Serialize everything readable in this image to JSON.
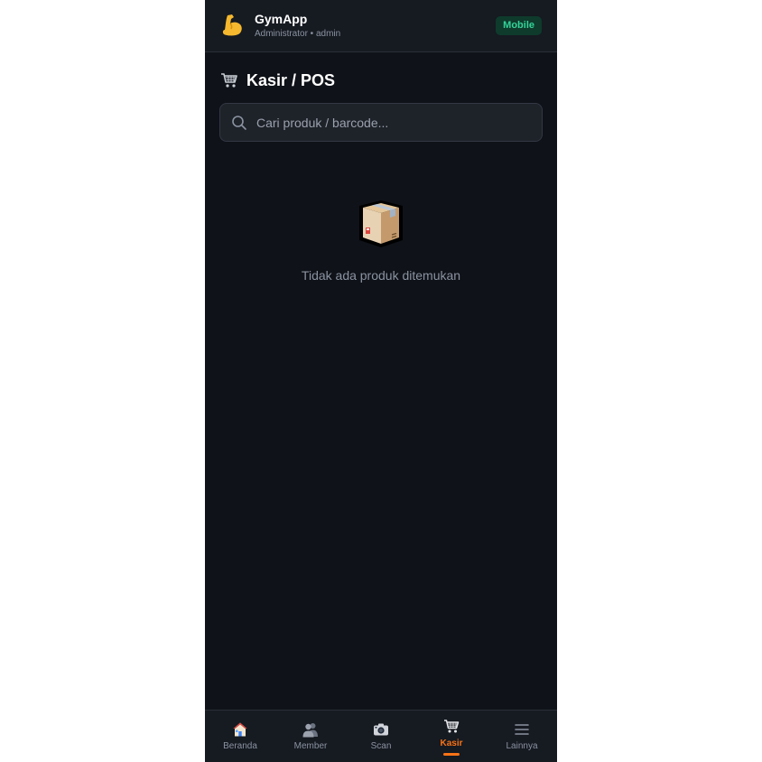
{
  "header": {
    "logo_icon": "flexed-biceps-icon",
    "app_name": "GymApp",
    "user_role": "Administrator • admin",
    "mode_badge": "Mobile",
    "badge_color": "#34d399"
  },
  "page": {
    "title_icon": "shopping-cart-icon",
    "title": "Kasir / POS"
  },
  "search": {
    "placeholder": "Cari produk / barcode...",
    "value": ""
  },
  "empty_state": {
    "icon": "package-box-icon",
    "message": "Tidak ada produk ditemukan"
  },
  "bottom_nav": {
    "active_color": "#f97316",
    "items": [
      {
        "label": "Beranda",
        "icon": "house-icon",
        "active": false
      },
      {
        "label": "Member",
        "icon": "people-icon",
        "active": false
      },
      {
        "label": "Scan",
        "icon": "camera-icon",
        "active": false
      },
      {
        "label": "Kasir",
        "icon": "shopping-cart-icon",
        "active": true
      },
      {
        "label": "Lainnya",
        "icon": "menu-icon",
        "active": false
      }
    ]
  }
}
